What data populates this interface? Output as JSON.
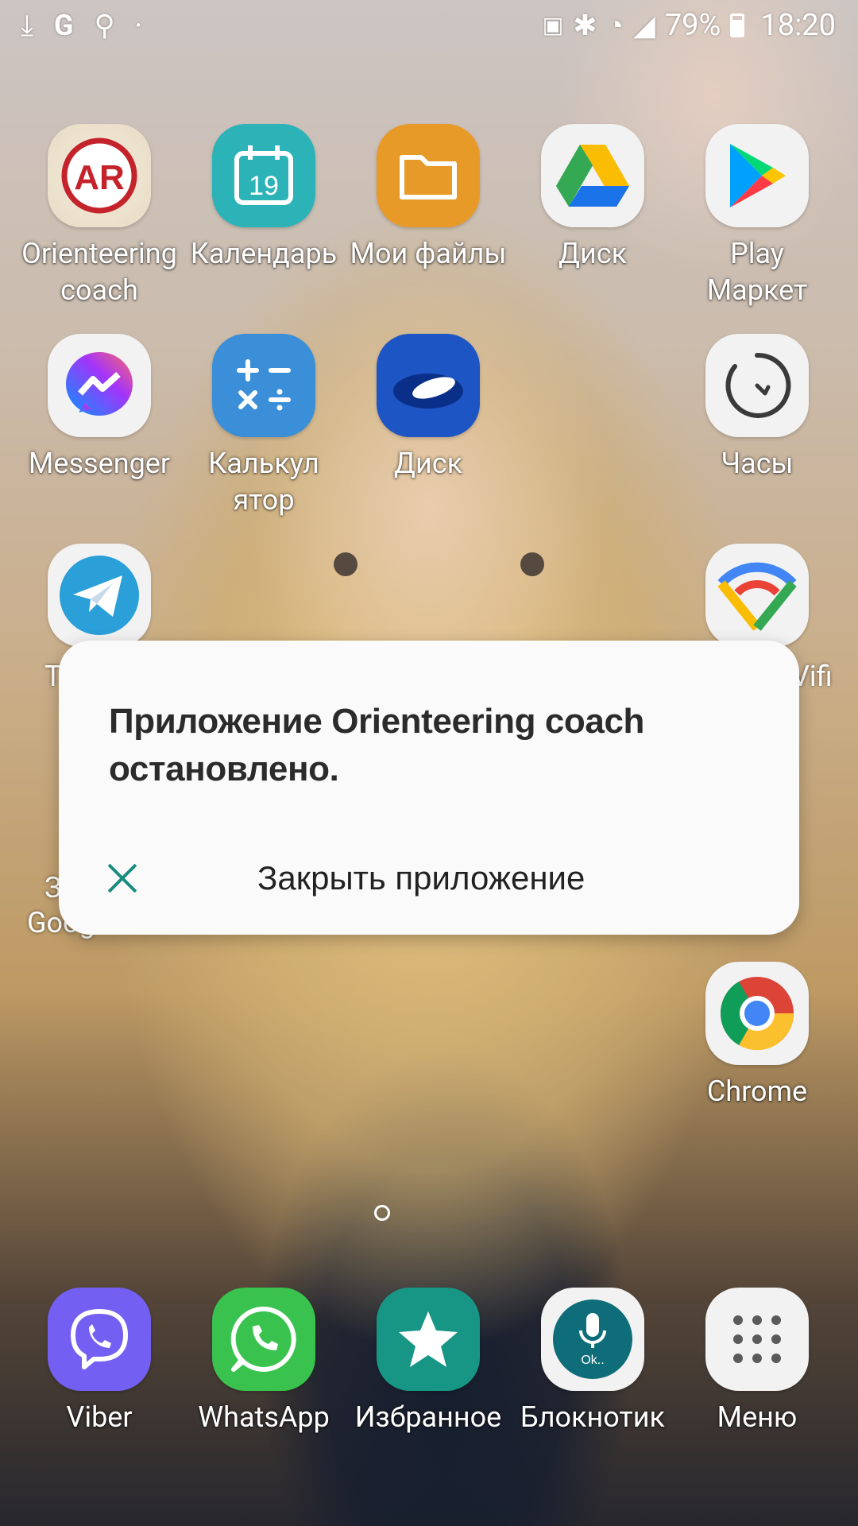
{
  "status_bar": {
    "battery_percent": "79%",
    "time": "18:20",
    "left_icons": [
      "download-icon",
      "google-icon",
      "keyhole-icon",
      "dot-icon"
    ],
    "right_icons": [
      "battery-saver-icon",
      "bluetooth-icon",
      "wifi-icon",
      "signal-icon",
      "battery-icon"
    ]
  },
  "apps": [
    {
      "label": "Orienteering\ncoach",
      "icon": "orienteering-ar-icon"
    },
    {
      "label": "Календарь",
      "icon": "calendar-icon",
      "day": "19"
    },
    {
      "label": "Мои файлы",
      "icon": "folder-icon"
    },
    {
      "label": "Диск",
      "icon": "google-drive-icon"
    },
    {
      "label": "Play\nМаркет",
      "icon": "play-store-icon"
    },
    {
      "label": "Messenger",
      "icon": "messenger-icon"
    },
    {
      "label": "Калькул\nятор",
      "icon": "calculator-icon"
    },
    {
      "label": "Диск",
      "icon": "yandex-disk-icon"
    },
    {
      "label": "Часы",
      "icon": "clock-icon"
    },
    {
      "label": "Chrome",
      "icon": "chrome-icon"
    }
  ],
  "partial_labels": {
    "telegram_fragment": "T",
    "wifi_fragment": "Vifi",
    "google_fragment_1": "З",
    "google_fragment_2": "Goog"
  },
  "dock": [
    {
      "label": "Viber",
      "icon": "viber-icon"
    },
    {
      "label": "WhatsApp",
      "icon": "whatsapp-icon"
    },
    {
      "label": "Избранное",
      "icon": "star-icon"
    },
    {
      "label": "Блокнотик",
      "icon": "microphone-icon",
      "badge": "Ok.."
    },
    {
      "label": "Меню",
      "icon": "app-grid-icon"
    }
  ],
  "dialog": {
    "title": "Приложение Orienteering coach остановлено.",
    "action_label": "Закрыть приложение"
  },
  "colors": {
    "dialog_bg": "#fafafa",
    "close_icon": "#188b7f"
  }
}
